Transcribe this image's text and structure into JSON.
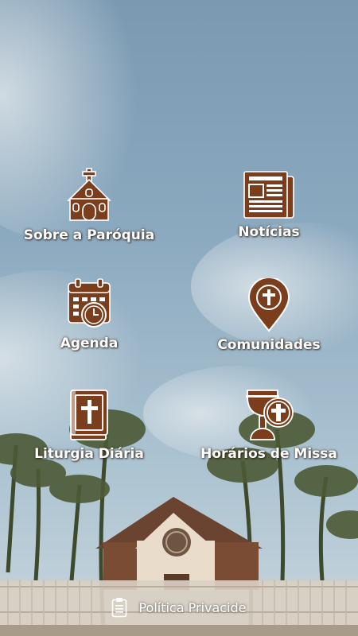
{
  "menu": {
    "items": [
      {
        "label": "Sobre a Paróquia",
        "icon": "church-icon"
      },
      {
        "label": "Notícias",
        "icon": "newspaper-icon"
      },
      {
        "label": "Agenda",
        "icon": "calendar-clock-icon"
      },
      {
        "label": "Comunidades",
        "icon": "location-cross-icon"
      },
      {
        "label": "Liturgia Diária",
        "icon": "bible-icon"
      },
      {
        "label": "Horários de Missa",
        "icon": "chalice-host-icon"
      }
    ]
  },
  "footer": {
    "label": "Política Privacide",
    "icon": "clipboard-icon"
  },
  "colors": {
    "icon_fill": "#7a3e1d",
    "icon_stroke": "#ffffff",
    "label_text": "#ffffff"
  }
}
